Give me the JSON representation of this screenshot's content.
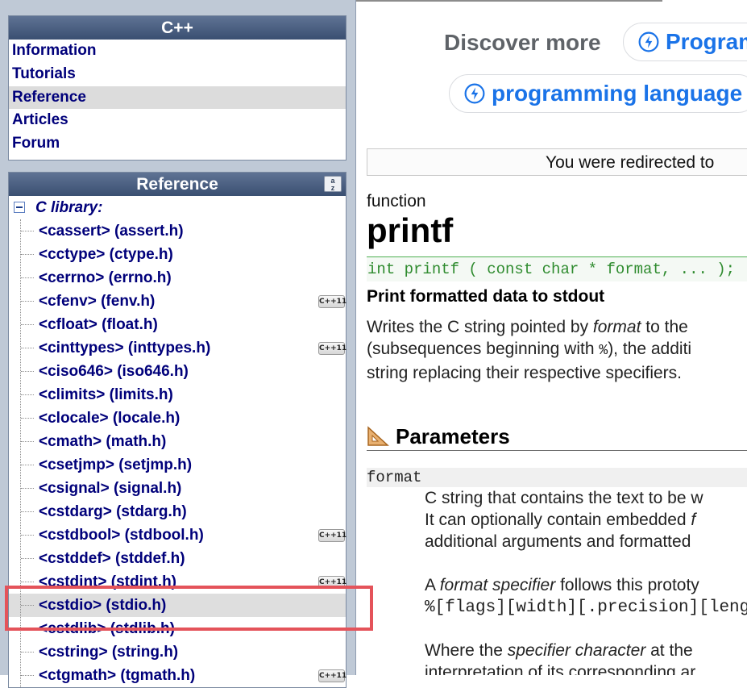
{
  "sidebar": {
    "cpp_box": {
      "title": "C++",
      "items": [
        "Information",
        "Tutorials",
        "Reference",
        "Articles",
        "Forum"
      ],
      "active": "Reference"
    },
    "ref_box": {
      "title": "Reference",
      "sort_icon": "a-z-sort-icon",
      "root_label": "C library:",
      "items": [
        {
          "label": "<cassert> (assert.h)",
          "badge": ""
        },
        {
          "label": "<cctype> (ctype.h)",
          "badge": ""
        },
        {
          "label": "<cerrno> (errno.h)",
          "badge": ""
        },
        {
          "label": "<cfenv> (fenv.h)",
          "badge": "C++11"
        },
        {
          "label": "<cfloat> (float.h)",
          "badge": ""
        },
        {
          "label": "<cinttypes> (inttypes.h)",
          "badge": "C++11"
        },
        {
          "label": "<ciso646> (iso646.h)",
          "badge": ""
        },
        {
          "label": "<climits> (limits.h)",
          "badge": ""
        },
        {
          "label": "<clocale> (locale.h)",
          "badge": ""
        },
        {
          "label": "<cmath> (math.h)",
          "badge": ""
        },
        {
          "label": "<csetjmp> (setjmp.h)",
          "badge": ""
        },
        {
          "label": "<csignal> (signal.h)",
          "badge": ""
        },
        {
          "label": "<cstdarg> (stdarg.h)",
          "badge": ""
        },
        {
          "label": "<cstdbool> (stdbool.h)",
          "badge": "C++11"
        },
        {
          "label": "<cstddef> (stddef.h)",
          "badge": ""
        },
        {
          "label": "<cstdint> (stdint.h)",
          "badge": "C++11"
        },
        {
          "label": "<cstdio> (stdio.h)",
          "badge": ""
        },
        {
          "label": "<cstdlib> (stdlib.h)",
          "badge": ""
        },
        {
          "label": "<cstring> (string.h)",
          "badge": ""
        },
        {
          "label": "<ctgmath> (tgmath.h)",
          "badge": "C++11"
        }
      ],
      "selected": "<cstdio> (stdio.h)"
    }
  },
  "main": {
    "discover_label": "Discover more",
    "chips": [
      "Program",
      "programming language"
    ],
    "redirect_text": "You were redirected to",
    "kind": "function",
    "name": "printf",
    "prototype": "int printf ( const char * format, ... );",
    "summary": "Print formatted data to stdout",
    "desc": {
      "l1a": "Writes the C string pointed by ",
      "l1b": "format",
      "l1c": " to the",
      "l2a": "(subsequences beginning with ",
      "l2b": "%",
      "l2c": "), the additi",
      "l3": "string replacing their respective specifiers."
    },
    "params_heading": "Parameters",
    "param_name": "format",
    "param_desc": {
      "p1": "C string that contains the text to be w",
      "p2a": "It can optionally contain embedded ",
      "p2b": "f",
      "p3": "additional arguments and formatted",
      "p4a": "A ",
      "p4b": "format specifier",
      "p4c": " follows this prototy",
      "p5": "%[flags][width][.precision][length]sp",
      "p6a": "Where the ",
      "p6b": "specifier character",
      "p6c": " at the",
      "p7": "interpretation of its corresponding ar"
    }
  },
  "colors": {
    "sidebar_bg": "#bfc9d6",
    "header_bg": "#3a4f71",
    "link": "#00007a",
    "chip_blue": "#1a73e8",
    "code_green": "#2e8b2e",
    "highlight": "#e4535a"
  }
}
